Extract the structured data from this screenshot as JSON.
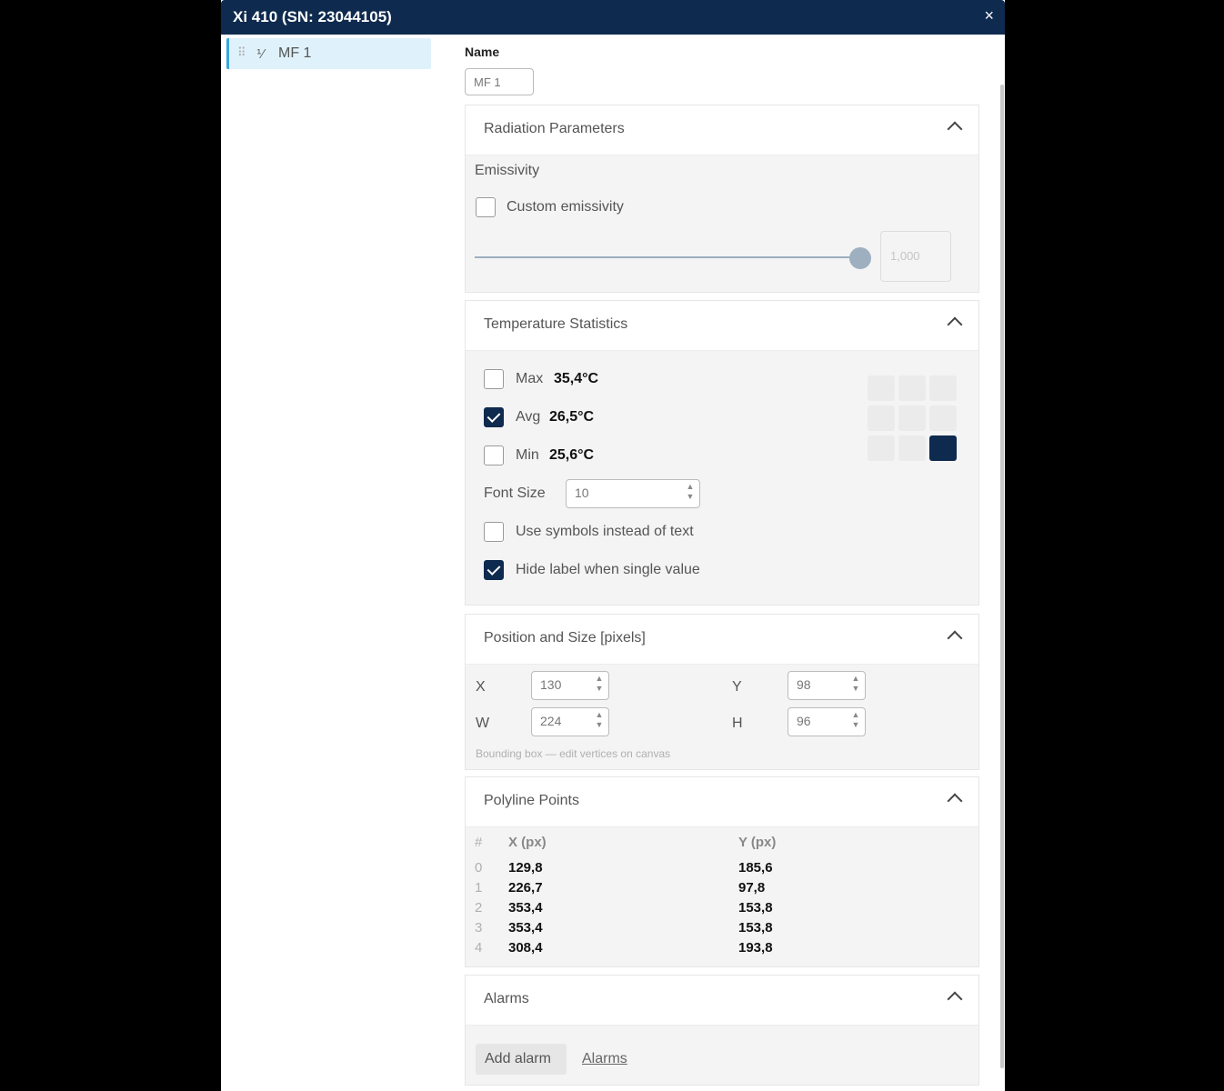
{
  "window": {
    "title": "Xi 410 (SN: 23044105)",
    "close_glyph": "×"
  },
  "tree": {
    "items": [
      {
        "drag_glyph": "⠿",
        "icon": "polyline-icon",
        "icon_glyph": "⅟",
        "label": "MF 1"
      }
    ]
  },
  "name": {
    "label": "Name",
    "value": "MF 1"
  },
  "radiation": {
    "title": "Radiation Parameters",
    "emissivity_label": "Emissivity",
    "custom_label": "Custom emissivity",
    "custom_checked": false,
    "value_placeholder": "1,000",
    "slider_fraction": 1.0
  },
  "temperature": {
    "title": "Temperature Statistics",
    "max_label": "Max",
    "max_value": "35,4°C",
    "max_checked": false,
    "avg_label": "Avg",
    "avg_value": "26,5°C",
    "avg_checked": true,
    "min_label": "Min",
    "min_value": "25,6°C",
    "min_checked": false,
    "font_size_label": "Font Size",
    "font_size_value": "10",
    "symbols_label": "Use symbols instead of text",
    "symbols_checked": false,
    "hide_label": "Hide label when single value",
    "hide_checked": true,
    "anchor_grid": {
      "rows": 3,
      "cols": 3,
      "active": "bottom-right"
    }
  },
  "position": {
    "title": "Position and Size [pixels]",
    "x_label": "X",
    "x_value": "130",
    "y_label": "Y",
    "y_value": "98",
    "w_label": "W",
    "w_value": "224",
    "h_label": "H",
    "h_value": "96",
    "note": "Bounding box — edit vertices on canvas"
  },
  "polyline": {
    "title": "Polyline Points",
    "headers": [
      "#",
      "X (px)",
      "Y (px)"
    ],
    "rows": [
      [
        "0",
        "129,8",
        "185,6"
      ],
      [
        "1",
        "226,7",
        "97,8"
      ],
      [
        "2",
        "353,4",
        "153,8"
      ],
      [
        "3",
        "353,4",
        "153,8"
      ],
      [
        "4",
        "308,4",
        "193,8"
      ]
    ]
  },
  "alarms": {
    "title": "Alarms",
    "add_label": "Add alarm",
    "link_label": "Alarms"
  },
  "colors": {
    "titlebar": "#0e2a4e",
    "accent": "#0e2a4e",
    "selection": "#dff2fb",
    "selection_border": "#3aa6dd"
  }
}
